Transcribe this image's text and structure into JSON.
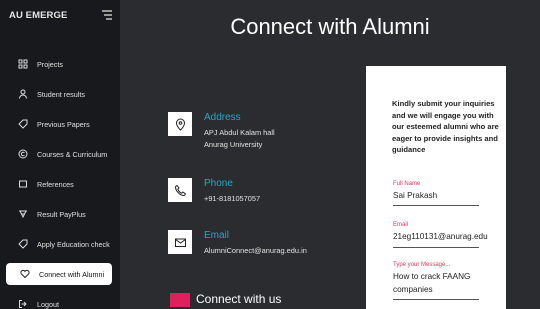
{
  "sidebar": {
    "brand": "AU EMERGE",
    "items": [
      {
        "label": "Projects",
        "icon": "grid-icon"
      },
      {
        "label": "Student results",
        "icon": "user-icon"
      },
      {
        "label": "Previous Papers",
        "icon": "tag-icon"
      },
      {
        "label": "Courses & Curriculum",
        "icon": "copyright-icon"
      },
      {
        "label": "References",
        "icon": "square-icon"
      },
      {
        "label": "Result PayPlus",
        "icon": "pay-icon"
      },
      {
        "label": "Apply Education check",
        "icon": "tag-icon"
      },
      {
        "label": "Connect with Alumni",
        "icon": "heart-icon"
      },
      {
        "label": "Logout",
        "icon": "logout-icon"
      }
    ]
  },
  "main": {
    "title": "Connect with Alumni",
    "address": {
      "title": "Address",
      "line1": "APJ Abdul Kalam hall",
      "line2": "Anurag University"
    },
    "phone": {
      "title": "Phone",
      "line1": "+91-8181057057"
    },
    "email": {
      "title": "Email",
      "line1": "AlumniConnect@anurag.edu.in"
    },
    "connect_heading": "Connect with us"
  },
  "form": {
    "heading": "Kindly submit your inquiries and we will engage you with our esteemed alumni who are eager to provide insights and guidance",
    "name_label": "Full Name",
    "name_value": "Sai Prakash",
    "email_label": "Email",
    "email_value": "21eg110131@anurag.edu",
    "message_label": "Type your Message...",
    "message_line1": "How to crack FAANG",
    "message_line2": "companies"
  },
  "colors": {
    "accent": "#2aa5c9",
    "brand_pink": "#e01f5e",
    "label_red": "#e0375f"
  }
}
